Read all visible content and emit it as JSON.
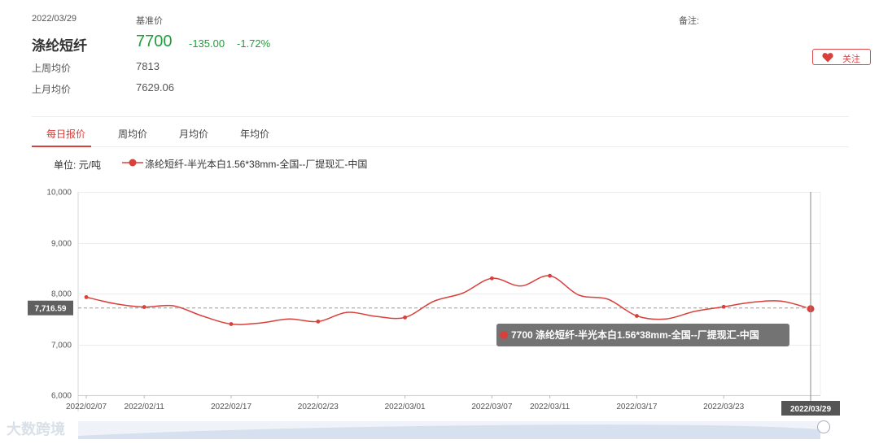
{
  "header": {
    "date": "2022/03/29",
    "base_price_label": "基准价",
    "note_label": "备注:",
    "product_name": "涤纶短纤",
    "price": "7700",
    "change": "-135.00",
    "change_pct": "-1.72%",
    "last_week_label": "上周均价",
    "last_week_value": "7813",
    "last_month_label": "上月均价",
    "last_month_value": "7629.06",
    "follow_label": "关注"
  },
  "tabs": [
    "每日报价",
    "周均价",
    "月均价",
    "年均价"
  ],
  "active_tab": 0,
  "legend": {
    "unit": "单位: 元/吨",
    "series_name": "涤纶短纤-半光本白1.56*38mm-全国--厂提现汇-中国"
  },
  "tooltip": {
    "text": "7700 涤纶短纤-半光本白1.56*38mm-全国--厂提现汇-中国"
  },
  "watermark": "大数跨境",
  "colors": {
    "line": "#d9403b",
    "up_down": "#1f9e3b",
    "accent": "#d9403b"
  },
  "chart_data": {
    "type": "line",
    "x_ticks": [
      "2022/02/07",
      "2022/02/11",
      "2022/02/17",
      "2022/02/23",
      "2022/03/01",
      "2022/03/07",
      "2022/03/11",
      "2022/03/17",
      "2022/03/23",
      "2022/03/29"
    ],
    "x": [
      "2022/02/07",
      "2022/02/09",
      "2022/02/11",
      "2022/02/13",
      "2022/02/15",
      "2022/02/17",
      "2022/02/19",
      "2022/02/21",
      "2022/02/23",
      "2022/02/25",
      "2022/02/27",
      "2022/03/01",
      "2022/03/03",
      "2022/03/05",
      "2022/03/07",
      "2022/03/09",
      "2022/03/11",
      "2022/03/13",
      "2022/03/15",
      "2022/03/17",
      "2022/03/19",
      "2022/03/21",
      "2022/03/23",
      "2022/03/25",
      "2022/03/27",
      "2022/03/29"
    ],
    "series": [
      {
        "name": "涤纶短纤-半光本白1.56*38mm-全国--厂提现汇-中国",
        "values": [
          7930,
          7800,
          7735,
          7760,
          7560,
          7400,
          7420,
          7500,
          7450,
          7630,
          7550,
          7530,
          7850,
          8010,
          8300,
          8150,
          8350,
          7970,
          7890,
          7560,
          7500,
          7650,
          7740,
          7830,
          7850,
          7700
        ]
      }
    ],
    "markers_at": [
      "2022/02/07",
      "2022/02/11",
      "2022/02/17",
      "2022/02/23",
      "2022/03/01",
      "2022/03/07",
      "2022/03/11",
      "2022/03/17",
      "2022/03/23",
      "2022/03/29"
    ],
    "y_ticks": [
      6000,
      7000,
      8000,
      9000,
      10000
    ],
    "ylim": [
      6000,
      10000
    ],
    "average_line": 7716.59,
    "average_label": "7,716.59",
    "highlight_x": "2022/03/29",
    "grid": true
  }
}
